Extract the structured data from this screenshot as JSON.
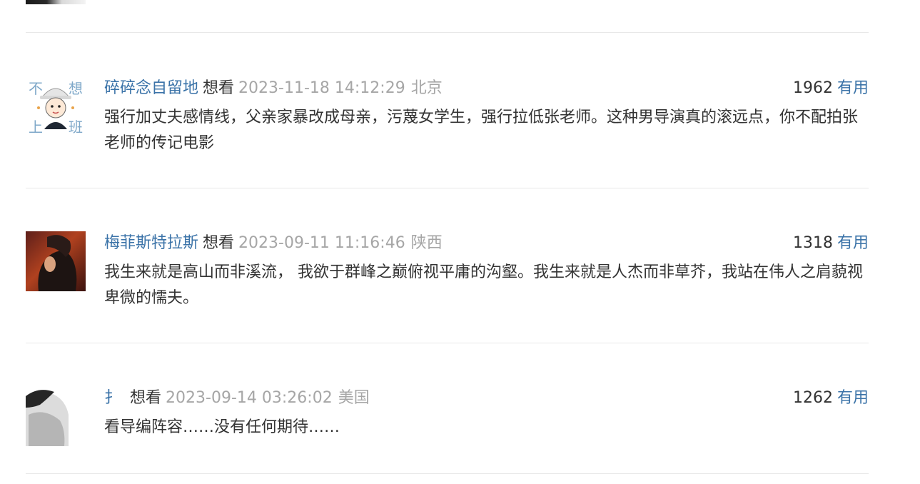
{
  "comments": [
    {
      "username": "碎碎念自留地",
      "status": "想看",
      "time": "2023-11-18 14:12:29",
      "location": "北京",
      "votes": "1962",
      "useful_label": "有用",
      "text": "强行加丈夫感情线，父亲家暴改成母亲，污蔑女学生，强行拉低张老师。这种男导演真的滚远点，你不配拍张老师的传记电影",
      "avatar_icon": "cartoon-girl-avatar",
      "avatar_text": [
        "不",
        "想",
        "上",
        "班"
      ]
    },
    {
      "username": "梅菲斯特拉斯",
      "status": "想看",
      "time": "2023-09-11 11:16:46",
      "location": "陕西",
      "votes": "1318",
      "useful_label": "有用",
      "text": "我生来就是高山而非溪流， 我欲于群峰之巅俯视平庸的沟壑。我生来就是人杰而非草芥，我站在伟人之肩藐视卑微的懦夫。",
      "avatar_icon": "painted-portrait-avatar"
    },
    {
      "username": "扌",
      "status": "想看",
      "time": "2023-09-14 03:26:02",
      "location": "美国",
      "votes": "1262",
      "useful_label": "有用",
      "text": "看导编阵容……没有任何期待……",
      "avatar_icon": "grayscale-photo-avatar"
    }
  ],
  "colors": {
    "link": "#3b73a8",
    "meta": "#a6a6a6",
    "text": "#333333",
    "divider": "#e8e8e8"
  }
}
